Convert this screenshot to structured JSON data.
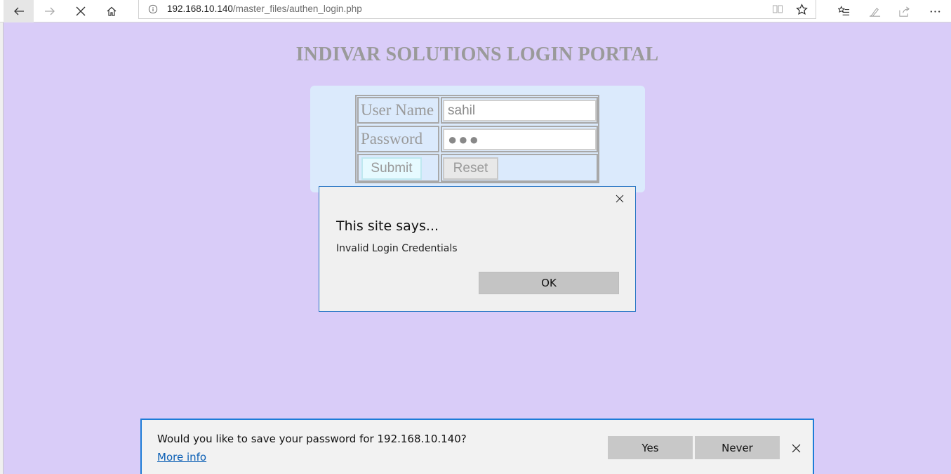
{
  "browser": {
    "url_host": "192.168.10.140",
    "url_path": "/master_files/authen_login.php"
  },
  "page": {
    "title": "INDIVAR SOLUTIONS LOGIN PORTAL",
    "username_label": "User Name",
    "username_value": "sahil",
    "password_label": "Password",
    "password_mask": "●●●",
    "submit_label": "Submit",
    "reset_label": "Reset"
  },
  "dialog": {
    "title": "This site says...",
    "message": "Invalid Login Credentials",
    "ok_label": "OK"
  },
  "save_password_bar": {
    "question": "Would you like to save your password for 192.168.10.140?",
    "more_info": "More info",
    "yes_label": "Yes",
    "never_label": "Never"
  },
  "colors": {
    "page_background": "#d9ccf8",
    "panel_background": "#dbeafc",
    "dialog_border": "#2b78c5",
    "savebar_border": "#1e7cd7"
  }
}
